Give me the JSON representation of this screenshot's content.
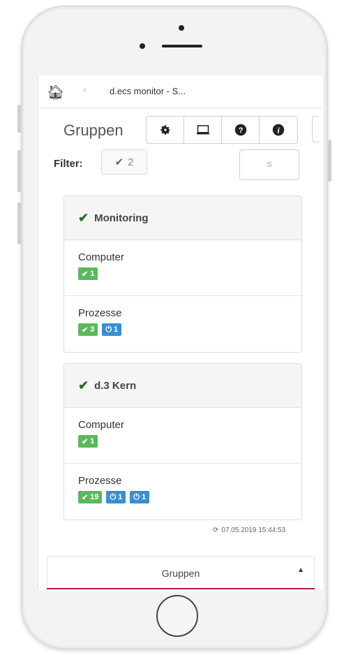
{
  "topbar": {
    "home_icon": "home-icon",
    "back_icon": "chevron-left-icon",
    "title": "d.ecs monitor - S..."
  },
  "header": {
    "section_title": "Gruppen"
  },
  "toolbar": {
    "icons": [
      "gear-icon",
      "monitor-icon",
      "question-circle-icon",
      "info-circle-icon"
    ]
  },
  "filter": {
    "label": "Filter:",
    "value": "2"
  },
  "search": {
    "placeholder": "S"
  },
  "groups": [
    {
      "title": "Monitoring",
      "rows": [
        {
          "label": "Computer",
          "badges": [
            {
              "type": "ok",
              "value": "1"
            }
          ]
        },
        {
          "label": "Prozesse",
          "badges": [
            {
              "type": "ok",
              "value": "3"
            },
            {
              "type": "power",
              "value": "1"
            }
          ]
        }
      ]
    },
    {
      "title": "d.3 Kern",
      "rows": [
        {
          "label": "Computer",
          "badges": [
            {
              "type": "ok",
              "value": "1"
            }
          ]
        },
        {
          "label": "Prozesse",
          "badges": [
            {
              "type": "ok",
              "value": "19"
            },
            {
              "type": "power",
              "value": "1"
            },
            {
              "type": "power",
              "value": "1"
            }
          ]
        }
      ]
    }
  ],
  "status": {
    "timestamp": "07.05.2019 15:44:53"
  },
  "bottom_nav": {
    "label": "Gruppen"
  },
  "colors": {
    "ok_green": "#5cb85c",
    "power_blue": "#3a8fd1",
    "accent": "#b0175c",
    "check_dark": "#2e6b2e"
  }
}
